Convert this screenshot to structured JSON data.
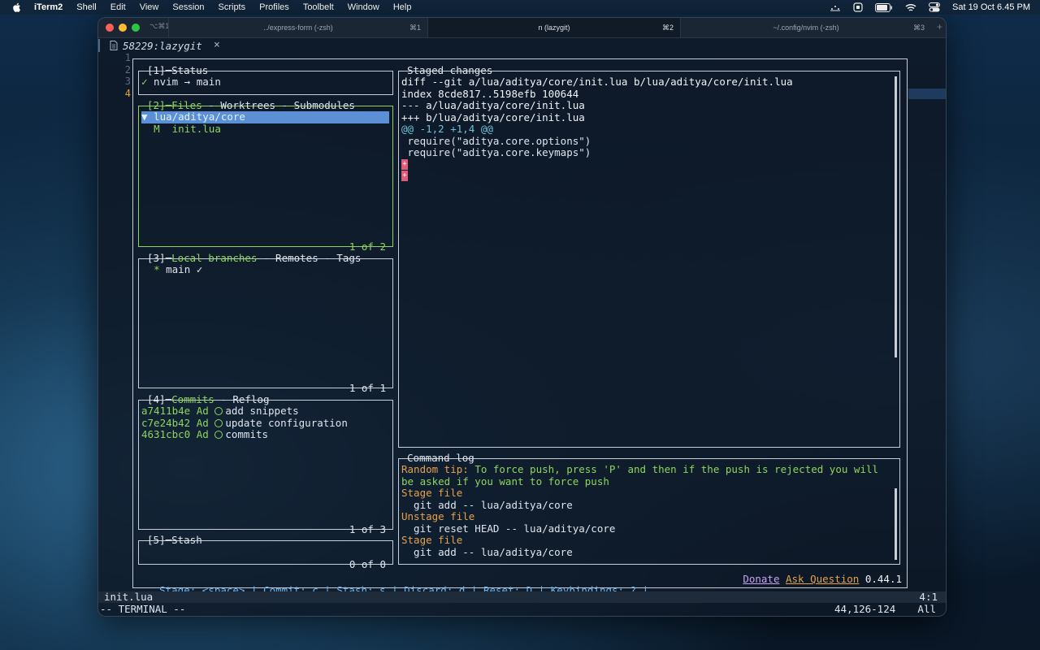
{
  "menubar": {
    "app_name": "iTerm2",
    "items": [
      "Shell",
      "Edit",
      "View",
      "Session",
      "Scripts",
      "Profiles",
      "Toolbelt",
      "Window",
      "Help"
    ],
    "clock": "Sat 19 Oct  6.45 PM",
    "status_icons": [
      "control-dots-icon",
      "screen-icon",
      "battery-icon",
      "wifi-icon",
      "control-center-icon"
    ]
  },
  "window": {
    "shortcut": "⌥⌘1",
    "tabs": [
      {
        "label": "../express-form (-zsh)",
        "shortcut": "⌘1",
        "active": false
      },
      {
        "label": "n (lazygit)",
        "shortcut": "⌘2",
        "active": true
      },
      {
        "label": "~/.config/nvim (-zsh)",
        "shortcut": "⌘3",
        "active": false
      }
    ],
    "new_tab": "+"
  },
  "buffer": {
    "name": "58229:lazygit",
    "close": "×",
    "line_numbers": [
      "1",
      "2",
      "3",
      "4"
    ]
  },
  "lazygit": {
    "status": {
      "title_num": "[1]",
      "title": "Status",
      "line_check": "✓",
      "line_text": " nvim → main"
    },
    "files": {
      "title_num": "[2]",
      "title_active": "Files",
      "title_rest": " - Worktrees - Submodules",
      "dir": "▼ lua/aditya/core",
      "file_status": "M",
      "file_name": "init.lua",
      "footer": "1 of 2"
    },
    "branches": {
      "title_num": "[3]",
      "title_active": "Local branches",
      "title_rest": " - Remotes - Tags",
      "branch_star": "*",
      "branch_name": "main ✓",
      "footer": "1 of 1"
    },
    "commits": {
      "title_num": "[4]",
      "title_active": "Commits",
      "title_rest": " - Reflog",
      "items": [
        {
          "hash": "a7411b4e",
          "author": "Ad",
          "message": "add snippets"
        },
        {
          "hash": "c7e24b42",
          "author": "Ad",
          "message": "update configuration"
        },
        {
          "hash": "4631cbc0",
          "author": "Ad",
          "message": "commits"
        }
      ],
      "footer": "1 of 3"
    },
    "stash": {
      "title_num": "[5]",
      "title": "Stash",
      "footer": "0 of 0"
    },
    "staged": {
      "title": "Staged changes",
      "lines": [
        "diff --git a/lua/aditya/core/init.lua b/lua/aditya/core/init.lua",
        "index 8cde817..5198efb 100644",
        "--- a/lua/aditya/core/init.lua",
        "+++ b/lua/aditya/core/init.lua"
      ],
      "hunk": "@@ -1,2 +1,4 @@",
      "context": [
        " require(\"aditya.core.options\")",
        " require(\"aditya.core.keymaps\")"
      ],
      "added": [
        "+",
        "+"
      ]
    },
    "command_log": {
      "title": "Command log",
      "tip_label": "Random tip:",
      "tip_text": " To force push, press 'P' and then if the push is rejected you will",
      "tip_text2": "be asked if you want to force push",
      "entries": [
        {
          "action": "Stage file",
          "cmd": "  git add -- lua/aditya/core"
        },
        {
          "action": "Unstage file",
          "cmd": "  git reset HEAD -- lua/aditya/core"
        },
        {
          "action": "Stage file",
          "cmd": "  git add -- lua/aditya/core"
        }
      ]
    },
    "keybinds": "Stage: <space> | Commit: c | Stash: s | Discard: d | Reset: D | Keybindings: ? | …",
    "donate": "Donate",
    "ask": "Ask Question",
    "version": "0.44.1"
  },
  "statusline": {
    "file": "init.lua",
    "position": "4:1"
  },
  "modeline": {
    "mode": "-- TERMINAL --",
    "cursor": "44,126-124",
    "scroll": "All"
  }
}
